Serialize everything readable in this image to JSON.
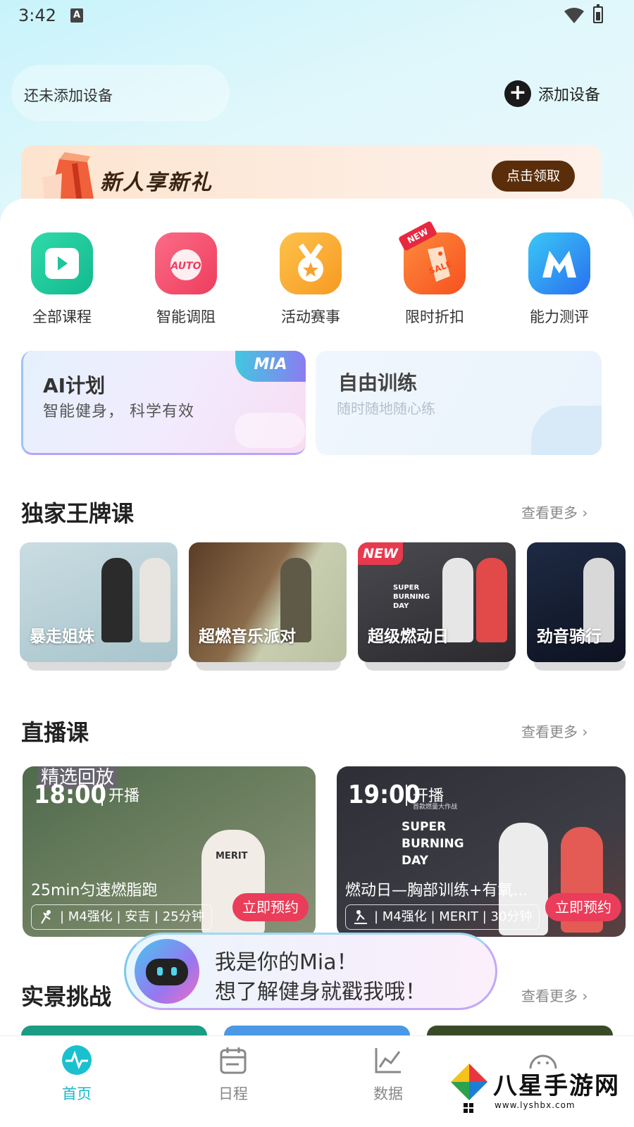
{
  "status_bar": {
    "time": "3:42",
    "notification_letter": "A"
  },
  "header": {
    "device_status": "还未添加设备",
    "add_device_label": "添加设备"
  },
  "promo": {
    "title": "新人享新礼",
    "button_label": "点击领取"
  },
  "categories": [
    {
      "label": "全部课程",
      "icon": "play-video-icon",
      "color": "#20c99a"
    },
    {
      "label": "智能调阻",
      "icon": "auto-resistance-icon",
      "color": "#f04e6d"
    },
    {
      "label": "活动赛事",
      "icon": "medal-icon",
      "color": "#f9a12f"
    },
    {
      "label": "限时折扣",
      "icon": "sale-tag-icon",
      "color": "#f96a2c",
      "badge": "NEW"
    },
    {
      "label": "能力测评",
      "icon": "m-logo-icon",
      "color": "#2a8df0"
    }
  ],
  "plans": {
    "ai": {
      "title": "AI计划",
      "subtitle": "智能健身， 科学有效",
      "tag": "MIA"
    },
    "free": {
      "title": "自由训练",
      "subtitle": "随时随地随心练"
    }
  },
  "brand_section": {
    "title": "独家王牌课",
    "more": "查看更多",
    "items": [
      {
        "name": "暴走姐妹",
        "bg": "#b9cfd6"
      },
      {
        "name": "超燃音乐派对",
        "bg": "#7b6147"
      },
      {
        "name": "超级燃动日",
        "bg": "#3a3a40",
        "badge": "NEW",
        "inner_title": "SUPER BURNING DAY"
      },
      {
        "name": "劲音骑行",
        "bg": "#151c2c"
      }
    ]
  },
  "live_section": {
    "title": "直播课",
    "more": "查看更多",
    "items": [
      {
        "replay_tag": "精选回放",
        "time": "18:00",
        "status": "开播",
        "name": "25min匀速燃脂跑",
        "meta": "| M4强化 | 安吉 | 25分钟",
        "book": "立即预约",
        "shirt_text": "MERIT"
      },
      {
        "time": "19:00",
        "status": "开播",
        "name": "燃动日—胸部训练+有氧...",
        "meta": "| M4强化 | MERIT | 30分钟",
        "book": "立即预约",
        "inner_title": "SUPER BURNING DAY",
        "inner_subtitle": "首款燃量大作战"
      }
    ]
  },
  "mia": {
    "line1": "我是你的Mia！",
    "line2": "想了解健身就戳我哦！"
  },
  "scene_section": {
    "title": "实景挑战",
    "more": "查看更多"
  },
  "bottom_nav": [
    {
      "label": "首页",
      "icon": "pulse-icon",
      "active": true
    },
    {
      "label": "日程",
      "icon": "calendar-icon",
      "active": false
    },
    {
      "label": "数据",
      "icon": "chart-icon",
      "active": false
    },
    {
      "label": "",
      "icon": "face-icon",
      "active": false
    }
  ],
  "watermark": {
    "text": "八星手游网",
    "url": "www.lyshbx.com"
  }
}
